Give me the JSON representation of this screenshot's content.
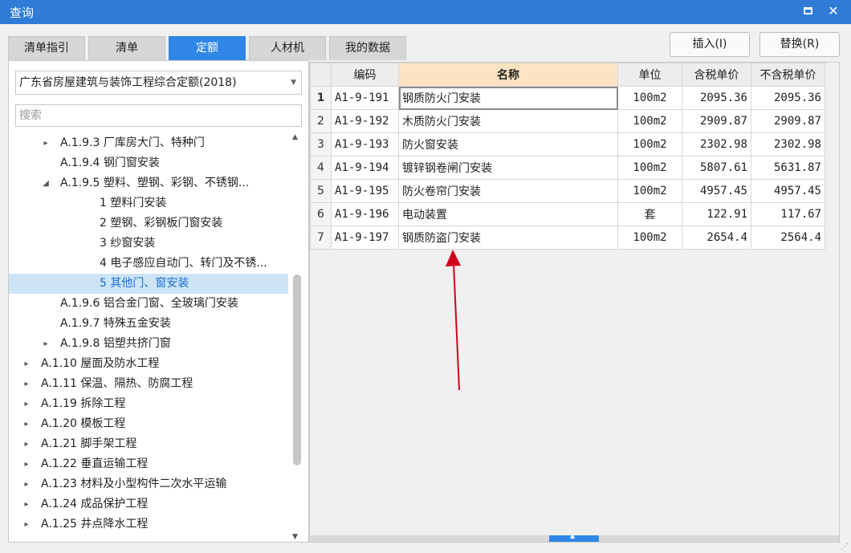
{
  "window": {
    "title": "查询",
    "maximize_icon": "maximize-icon",
    "close_label": "✕",
    "close_icon": "close-icon"
  },
  "tabs": [
    {
      "label": "清单指引",
      "active": false
    },
    {
      "label": "清单",
      "active": false
    },
    {
      "label": "定额",
      "active": true
    },
    {
      "label": "人材机",
      "active": false
    },
    {
      "label": "我的数据",
      "active": false
    }
  ],
  "left": {
    "library_select": "广东省房屋建筑与装饰工程综合定额(2018)",
    "search_placeholder": "搜索",
    "tree": [
      {
        "level": 2,
        "expander": "right",
        "label": "A.1.9.3 厂库房大门、特种门"
      },
      {
        "level": 2,
        "expander": "none",
        "label": "A.1.9.4 钢门窗安装"
      },
      {
        "level": 2,
        "expander": "down",
        "label": "A.1.9.5 塑料、塑钢、彩钢、不锈钢..."
      },
      {
        "level": 3,
        "expander": "none",
        "label": "1 塑料门安装"
      },
      {
        "level": 3,
        "expander": "none",
        "label": "2 塑钢、彩钢板门窗安装"
      },
      {
        "level": 3,
        "expander": "none",
        "label": "3 纱窗安装"
      },
      {
        "level": 3,
        "expander": "none",
        "label": "4 电子感应自动门、转门及不锈..."
      },
      {
        "level": 3,
        "expander": "none",
        "label": "5 其他门、窗安装",
        "selected": true
      },
      {
        "level": 2,
        "expander": "none",
        "label": "A.1.9.6 铝合金门窗、全玻璃门安装"
      },
      {
        "level": 2,
        "expander": "none",
        "label": "A.1.9.7 特殊五金安装"
      },
      {
        "level": 2,
        "expander": "right",
        "label": "A.1.9.8 铝塑共挤门窗"
      },
      {
        "level": 1,
        "expander": "right",
        "label": "A.1.10 屋面及防水工程"
      },
      {
        "level": 1,
        "expander": "right",
        "label": "A.1.11 保温、隔热、防腐工程"
      },
      {
        "level": 1,
        "expander": "right",
        "label": "A.1.19 拆除工程"
      },
      {
        "level": 1,
        "expander": "right",
        "label": "A.1.20 模板工程"
      },
      {
        "level": 1,
        "expander": "right",
        "label": "A.1.21 脚手架工程"
      },
      {
        "level": 1,
        "expander": "right",
        "label": "A.1.22 垂直运输工程"
      },
      {
        "level": 1,
        "expander": "right",
        "label": "A.1.23 材料及小型构件二次水平运输"
      },
      {
        "level": 1,
        "expander": "right",
        "label": "A.1.24 成品保护工程"
      },
      {
        "level": 1,
        "expander": "right",
        "label": "A.1.25 井点降水工程"
      }
    ]
  },
  "toolbar": {
    "insert_label": "插入(I)",
    "replace_label": "替换(R)"
  },
  "table": {
    "columns": [
      "",
      "编码",
      "名称",
      "单位",
      "含税单价",
      "不含税单价"
    ],
    "rows": [
      {
        "no": "1",
        "code": "A1-9-191",
        "name": "钢质防火门安装",
        "unit": "100m2",
        "price_tax": "2095.36",
        "price_notax": "2095.36"
      },
      {
        "no": "2",
        "code": "A1-9-192",
        "name": "木质防火门安装",
        "unit": "100m2",
        "price_tax": "2909.87",
        "price_notax": "2909.87"
      },
      {
        "no": "3",
        "code": "A1-9-193",
        "name": "防火窗安装",
        "unit": "100m2",
        "price_tax": "2302.98",
        "price_notax": "2302.98"
      },
      {
        "no": "4",
        "code": "A1-9-194",
        "name": "镀锌钢卷闸门安装",
        "unit": "100m2",
        "price_tax": "5807.61",
        "price_notax": "5631.87"
      },
      {
        "no": "5",
        "code": "A1-9-195",
        "name": "防火卷帘门安装",
        "unit": "100m2",
        "price_tax": "4957.45",
        "price_notax": "4957.45"
      },
      {
        "no": "6",
        "code": "A1-9-196",
        "name": "电动装置",
        "unit": "套",
        "price_tax": "122.91",
        "price_notax": "117.67"
      },
      {
        "no": "7",
        "code": "A1-9-197",
        "name": "钢质防盗门安装",
        "unit": "100m2",
        "price_tax": "2654.4",
        "price_notax": "2564.4"
      }
    ]
  },
  "colors": {
    "titlebar": "#2f7bd6",
    "active_tab": "#2f86e6",
    "header_highlight": "#fde3c3",
    "selected_tree": "#cde4f7",
    "annotation_arrow": "#d0021b"
  }
}
